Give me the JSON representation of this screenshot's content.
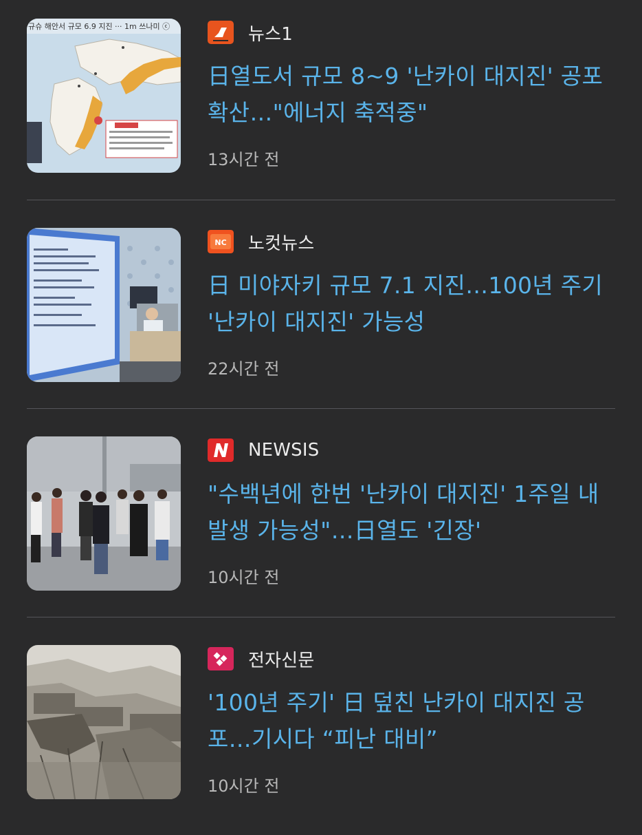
{
  "articles": [
    {
      "source": "뉴스1",
      "source_logo": "news1-logo-icon",
      "headline": "日열도서 규모 8~9 '난카이 대지진' 공포 확산…\"에너지 축적중\"",
      "time": "13시간 전",
      "thumbnail": "japan-earthquake-map-image",
      "thumbnail_text": "규슈 해안서 규모 6.9 지진 ··· 1m 쓰나미 ⓒ"
    },
    {
      "source": "노컷뉴스",
      "source_logo": "nocut-news-logo-icon",
      "headline": "日 미야자키 규모 7.1 지진…100년 주기 '난카이 대지진' 가능성",
      "time": "22시간 전",
      "thumbnail": "press-briefing-screen-image"
    },
    {
      "source": "NEWSIS",
      "source_logo": "newsis-logo-icon",
      "headline": "\"수백년에 한번 '난카이 대지진' 1주일 내 발생 가능성\"…日열도 '긴장'",
      "time": "10시간 전",
      "thumbnail": "evacuated-crowd-image"
    },
    {
      "source": "전자신문",
      "source_logo": "etnews-logo-icon",
      "headline": "'100년 주기' 日 덮친 난카이 대지진 공포…기시다 “피난 대비”",
      "time": "10시간 전",
      "thumbnail": "historic-earthquake-photo-image"
    }
  ],
  "colors": {
    "background": "#2a2a2b",
    "headline": "#5ab4ea",
    "source_text": "#ececec",
    "time_text": "#b8b8b8",
    "divider": "#55555a",
    "news1_logo": "#e8541e",
    "nocut_logo": "#f0521f",
    "newsis_logo": "#e02a2a",
    "etnews_logo": "#d6265b"
  }
}
